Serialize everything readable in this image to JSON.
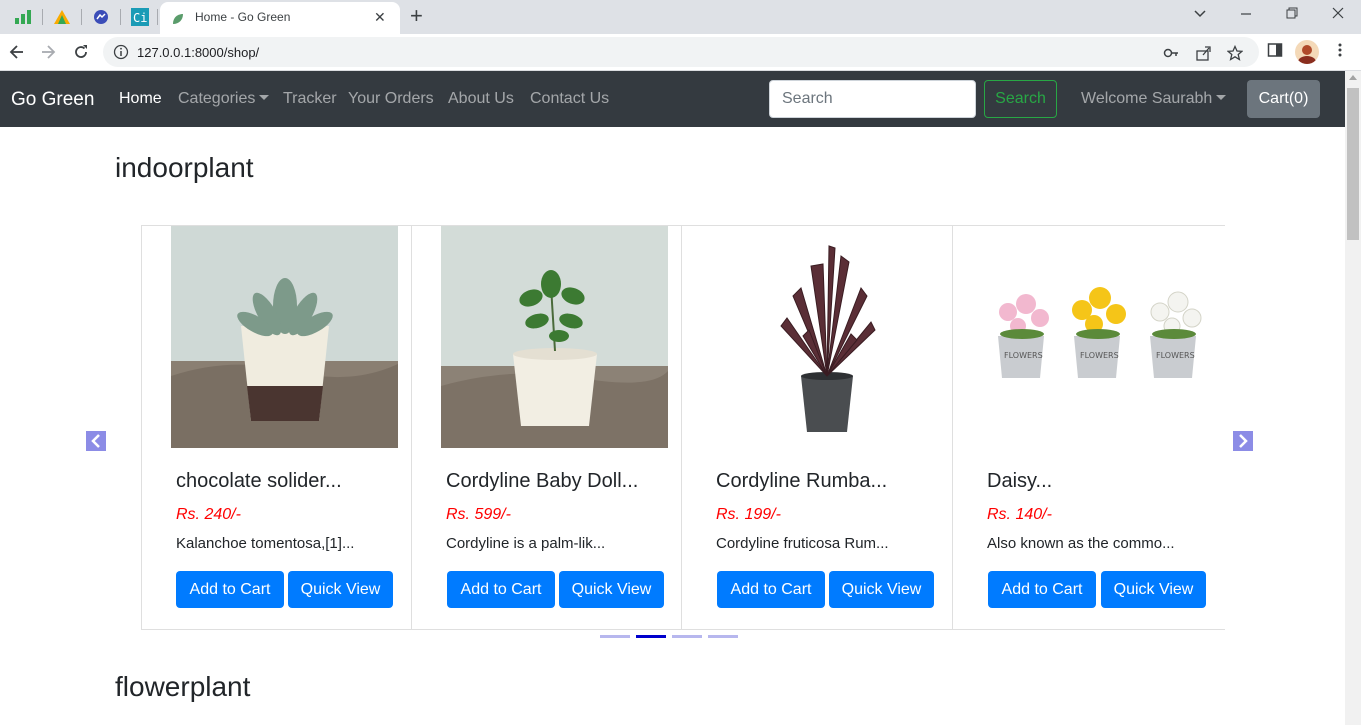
{
  "browser": {
    "tab_title": "Home - Go Green",
    "url": "127.0.0.1:8000/shop/"
  },
  "navbar": {
    "brand": "Go Green",
    "links": [
      "Home",
      "Categories",
      "Tracker",
      "Your Orders",
      "About Us",
      "Contact Us"
    ],
    "search_placeholder": "Search",
    "search_button": "Search",
    "welcome": "Welcome Saurabh",
    "cart": "Cart(0)"
  },
  "sections": [
    {
      "title": "indoorplant",
      "products": [
        {
          "name": "chocolate solider...",
          "price": "Rs. 240/-",
          "desc": "Kalanchoe tomentosa,[1]...",
          "add": "Add to Cart",
          "view": "Quick View"
        },
        {
          "name": "Cordyline Baby Doll...",
          "price": "Rs. 599/-",
          "desc": "Cordyline is a palm-lik...",
          "add": "Add to Cart",
          "view": "Quick View"
        },
        {
          "name": "Cordyline Rumba...",
          "price": "Rs. 199/-",
          "desc": "Cordyline fruticosa Rum...",
          "add": "Add to Cart",
          "view": "Quick View"
        },
        {
          "name": "Daisy...",
          "price": "Rs. 140/-",
          "desc": "Also known as the commo...",
          "add": "Add to Cart",
          "view": "Quick View"
        }
      ],
      "carousel": {
        "slides": 4,
        "active": 2
      }
    },
    {
      "title": "flowerplant"
    }
  ],
  "colors": {
    "navbar_bg": "#343a40",
    "primary": "#007bff",
    "success": "#28a745",
    "price": "#ff0000",
    "secondary": "#6c757d"
  }
}
